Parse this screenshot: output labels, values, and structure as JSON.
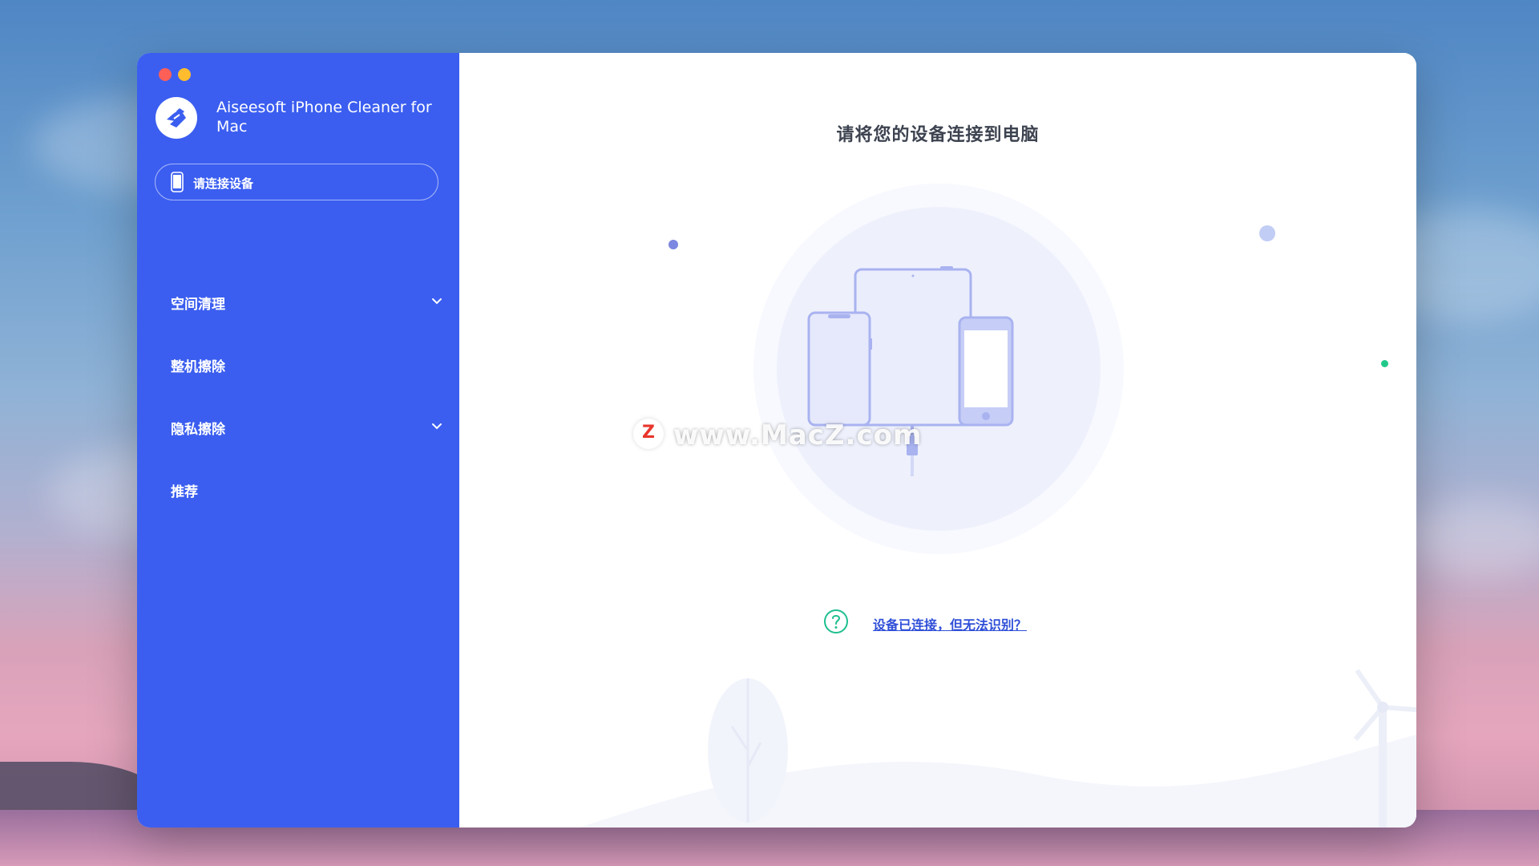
{
  "app": {
    "title": "Aiseesoft iPhone Cleaner for Mac"
  },
  "window_controls": [
    "close",
    "minimize"
  ],
  "sidebar": {
    "device_status": {
      "label": "请连接设备",
      "icon": "phone-icon"
    },
    "items": [
      {
        "label": "空间清理",
        "expandable": true
      },
      {
        "label": "整机擦除",
        "expandable": false
      },
      {
        "label": "隐私擦除",
        "expandable": true
      },
      {
        "label": "推荐",
        "expandable": false
      }
    ]
  },
  "main": {
    "title": "请将您的设备连接到电脑",
    "help_link": "设备已连接，但无法识别？",
    "help_icon": "question-circle-icon"
  },
  "watermark": {
    "badge": "Z",
    "text": "www.MacZ.com"
  },
  "colors": {
    "sidebar": "#3b5ef0",
    "accent_link": "#2f4fd8",
    "help_icon": "#1fbf8f",
    "title_text": "#3d4350"
  }
}
